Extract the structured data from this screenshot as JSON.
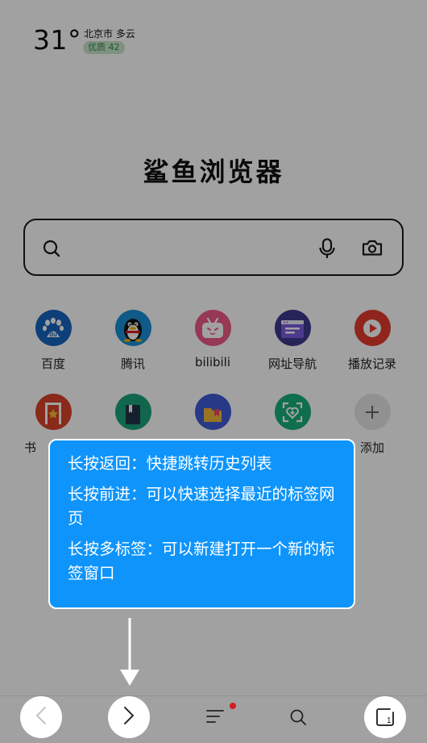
{
  "weather": {
    "temperature": "31°",
    "city_condition": "北京市  多云",
    "air_quality": "优质  42"
  },
  "logo": {
    "text": "鲨鱼浏览器"
  },
  "search": {
    "placeholder": "",
    "value": ""
  },
  "shortcuts": [
    {
      "label": "百度",
      "icon": "baidu-icon",
      "color": "#1565c0"
    },
    {
      "label": "腾讯",
      "icon": "qq-penguin-icon",
      "color": "#1a8fd6"
    },
    {
      "label": "bilibili",
      "icon": "bilibili-icon",
      "color": "#ef5a87"
    },
    {
      "label": "网址导航",
      "icon": "web-navigation-icon",
      "color": "#3d3a8c"
    },
    {
      "label": "播放记录",
      "icon": "play-history-icon",
      "color": "#e33b2e"
    },
    {
      "label": "书",
      "icon": "bookmark-book-icon",
      "color": "#d9432a"
    },
    {
      "label": "",
      "icon": "notebook-icon",
      "color": "#1aa37a"
    },
    {
      "label": "",
      "icon": "folder-icon",
      "color": "#3f5bd6"
    },
    {
      "label": "",
      "icon": "health-scan-icon",
      "color": "#18b07a"
    },
    {
      "label": "添加",
      "icon": "plus-icon",
      "color": "#e6e6e6"
    }
  ],
  "tooltip": {
    "line1": "长按返回：快捷跳转历史列表",
    "line2": "长按前进：可以快速选择最近的标签网页",
    "line3": "长按多标签：可以新建打开一个新的标签窗口"
  },
  "toolbar": {
    "back": "back-chevron-icon",
    "forward": "forward-chevron-icon",
    "menu": "menu-icon",
    "search": "search-icon",
    "tabs_count": "1"
  }
}
